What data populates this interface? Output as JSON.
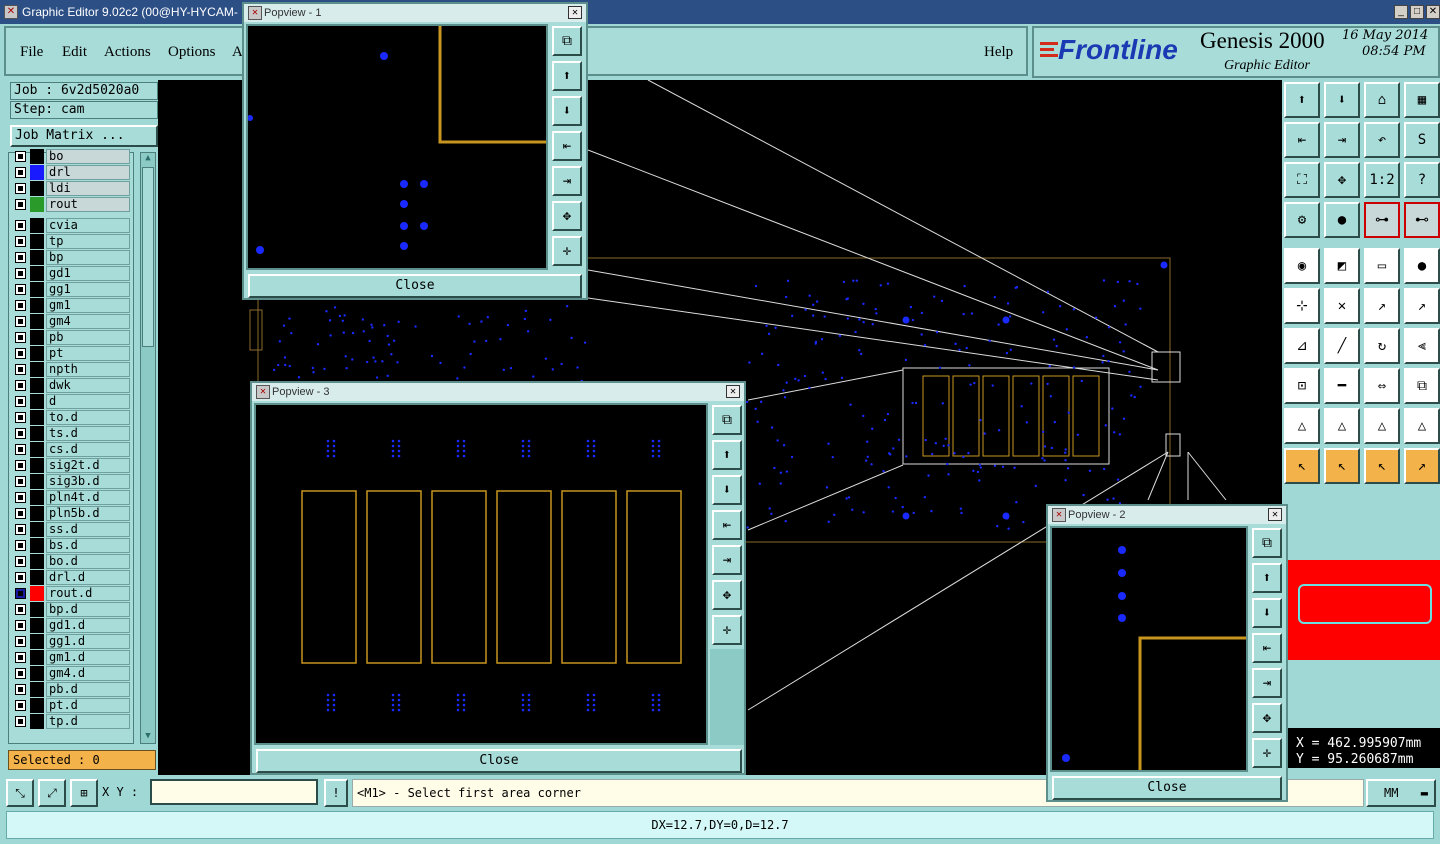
{
  "window": {
    "title": "Graphic Editor 9.02c2 (00@HY-HYCAM-",
    "icon": "x-window-icon"
  },
  "menu": {
    "file": "File",
    "edit": "Edit",
    "actions": "Actions",
    "options": "Options",
    "a": "A",
    "help": "Help"
  },
  "logo": {
    "brand": "Frontline",
    "product": "Genesis 2000",
    "subtitle": "Graphic Editor",
    "date": "16 May 2014",
    "time": "08:54 PM"
  },
  "job": {
    "job": "Job : 6v2d5020a0",
    "step": "Step: cam",
    "matrix_button": "Job Matrix ..."
  },
  "layers": [
    {
      "name": "bo",
      "color": "#000000"
    },
    {
      "name": "drl",
      "color": "#1a1aff"
    },
    {
      "name": "ldi",
      "color": "#000000"
    },
    {
      "name": "rout",
      "color": "#2a9a2a"
    },
    {
      "name": "cvia",
      "color": "#000000"
    },
    {
      "name": "tp",
      "color": "#000000"
    },
    {
      "name": "bp",
      "color": "#000000"
    },
    {
      "name": "gd1",
      "color": "#000000"
    },
    {
      "name": "gg1",
      "color": "#000000"
    },
    {
      "name": "gm1",
      "color": "#000000"
    },
    {
      "name": "gm4",
      "color": "#000000"
    },
    {
      "name": "pb",
      "color": "#000000"
    },
    {
      "name": "pt",
      "color": "#000000"
    },
    {
      "name": "npth",
      "color": "#000000"
    },
    {
      "name": "dwk",
      "color": "#000000"
    },
    {
      "name": "d",
      "color": "#000000"
    },
    {
      "name": "to.d",
      "color": "#000000"
    },
    {
      "name": "ts.d",
      "color": "#000000"
    },
    {
      "name": "cs.d",
      "color": "#000000"
    },
    {
      "name": "sig2t.d",
      "color": "#000000"
    },
    {
      "name": "sig3b.d",
      "color": "#000000"
    },
    {
      "name": "pln4t.d",
      "color": "#000000"
    },
    {
      "name": "pln5b.d",
      "color": "#000000"
    },
    {
      "name": "ss.d",
      "color": "#000000"
    },
    {
      "name": "bs.d",
      "color": "#000000"
    },
    {
      "name": "bo.d",
      "color": "#000000"
    },
    {
      "name": "drl.d",
      "color": "#000000"
    },
    {
      "name": "rout.d",
      "color": "#ff0000"
    },
    {
      "name": "bp.d",
      "color": "#000000"
    },
    {
      "name": "gd1.d",
      "color": "#000000"
    },
    {
      "name": "gg1.d",
      "color": "#000000"
    },
    {
      "name": "gm1.d",
      "color": "#000000"
    },
    {
      "name": "gm4.d",
      "color": "#000000"
    },
    {
      "name": "pb.d",
      "color": "#000000"
    },
    {
      "name": "pt.d",
      "color": "#000000"
    },
    {
      "name": "tp.d",
      "color": "#000000"
    }
  ],
  "status": {
    "selected": "Selected : 0",
    "xy_label": "X Y :",
    "xy_value": "",
    "prompt": "<M1> - Select first area corner",
    "bottom": "DX=12.7,DY=0,D=12.7",
    "units": "MM"
  },
  "coordinates": {
    "x": "X = 462.995907mm",
    "y": "Y = 95.260687mm"
  },
  "popviews": {
    "p1": {
      "title": "Popview - 1",
      "close": "Close"
    },
    "p2": {
      "title": "Popview - 2",
      "close": "Close"
    },
    "p3": {
      "title": "Popview - 3",
      "close": "Close"
    }
  },
  "colors": {
    "panel": "#a8dcd8",
    "drill": "#1a2aff",
    "rout": "#c8961e",
    "outline": "#8a6a2a"
  }
}
